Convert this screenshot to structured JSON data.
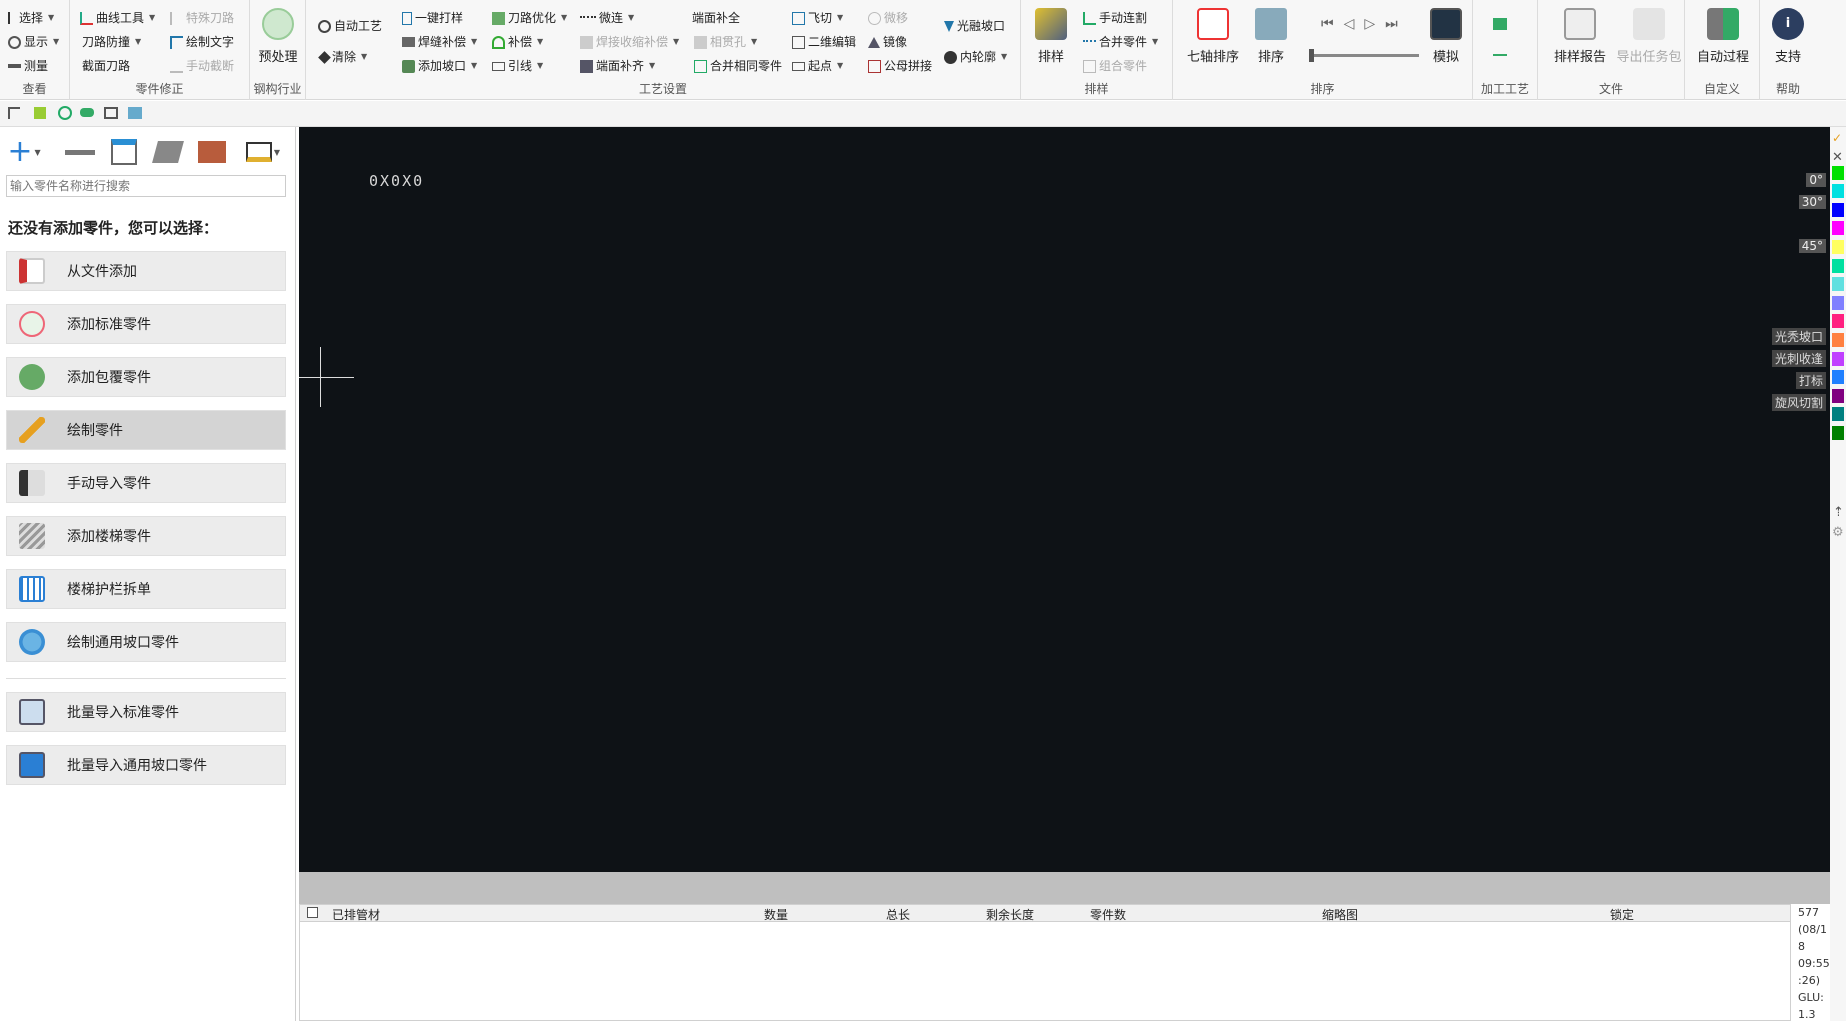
{
  "ribbon": {
    "view": {
      "select": "选择",
      "display": "显示",
      "measure": "测量",
      "label": "查看"
    },
    "part_fix": {
      "curve_tools": "曲线工具",
      "special_path": "特殊刀路",
      "path_guard": "刀路防撞",
      "draw_text": "绘制文字",
      "section_path": "截面刀路",
      "manual_break": "手动截断",
      "label": "零件修正"
    },
    "steel": {
      "preprocess": "预处理",
      "label": "钢构行业"
    },
    "process": {
      "auto_process": "自动工艺",
      "clear": "清除",
      "one_key_mark": "一键打样",
      "weld_comp": "焊缝补偿",
      "add_bevel": "添加坡口",
      "path_optimize": "刀路优化",
      "compensate": "补偿",
      "lead": "引线",
      "micro_connect": "微连",
      "weld_shrink": "焊接收缩补偿",
      "end_align": "端面补齐",
      "end_fill": "端面补全",
      "intersect_hole": "相贯孔",
      "merge_same": "合并相同零件",
      "fly_cut": "飞切",
      "edit_2d": "二维编辑",
      "start_point": "起点",
      "micro_move": "微移",
      "mirror": "镜像",
      "male_female": "公母拼接",
      "smooth_bevel": "光融坡口",
      "inner_contour": "内轮廓",
      "label": "工艺设置"
    },
    "nest": {
      "nest_btn": "排样",
      "manual_cut": "手动连割",
      "merge_parts": "合并零件",
      "group_parts": "组合零件",
      "label": "排样"
    },
    "sort": {
      "seven_axis": "七轴排序",
      "sort_btn": "排序",
      "simulate": "模拟",
      "label": "排序"
    },
    "craft": {
      "label": "加工工艺"
    },
    "file": {
      "report": "排样报告",
      "export_task": "导出任务包",
      "label": "文件"
    },
    "custom": {
      "auto_process": "自动过程",
      "label": "自定义"
    },
    "help": {
      "support": "支持",
      "label": "帮助"
    }
  },
  "leftpanel": {
    "search_placeholder": "输入零件名称进行搜索",
    "hint": "还没有添加零件，您可以选择：",
    "buttons": [
      "从文件添加",
      "添加标准零件",
      "添加包覆零件",
      "绘制零件",
      "手动导入零件",
      "添加楼梯零件",
      "楼梯护栏拆单",
      "绘制通用坡口零件"
    ],
    "batch_buttons": [
      "批量导入标准零件",
      "批量导入通用坡口零件"
    ]
  },
  "canvas": {
    "coord": "0X0X0",
    "angles": [
      "0°",
      "30°",
      "45°"
    ],
    "tags": [
      "光秃坡口",
      "光刺收逢",
      "打标",
      "旋风切割"
    ]
  },
  "table": {
    "headers": [
      "已排管材",
      "数量",
      "总长",
      "剩余长度",
      "零件数",
      "缩略图",
      "锁定"
    ]
  },
  "status": {
    "lines": [
      "577",
      "(08/1",
      "8",
      "09:55",
      ":26)",
      "GLU:",
      "1.3"
    ]
  },
  "colors": {
    "swatches": [
      "#00e000",
      "#00e0e0",
      "#0000ff",
      "#ff00ff",
      "#ffff60",
      "#00e0a0",
      "#60e0e0",
      "#8080ff",
      "#ff2080",
      "#ff8040",
      "#c040ff",
      "#2080ff",
      "#800080",
      "#008080",
      "#008000"
    ]
  }
}
